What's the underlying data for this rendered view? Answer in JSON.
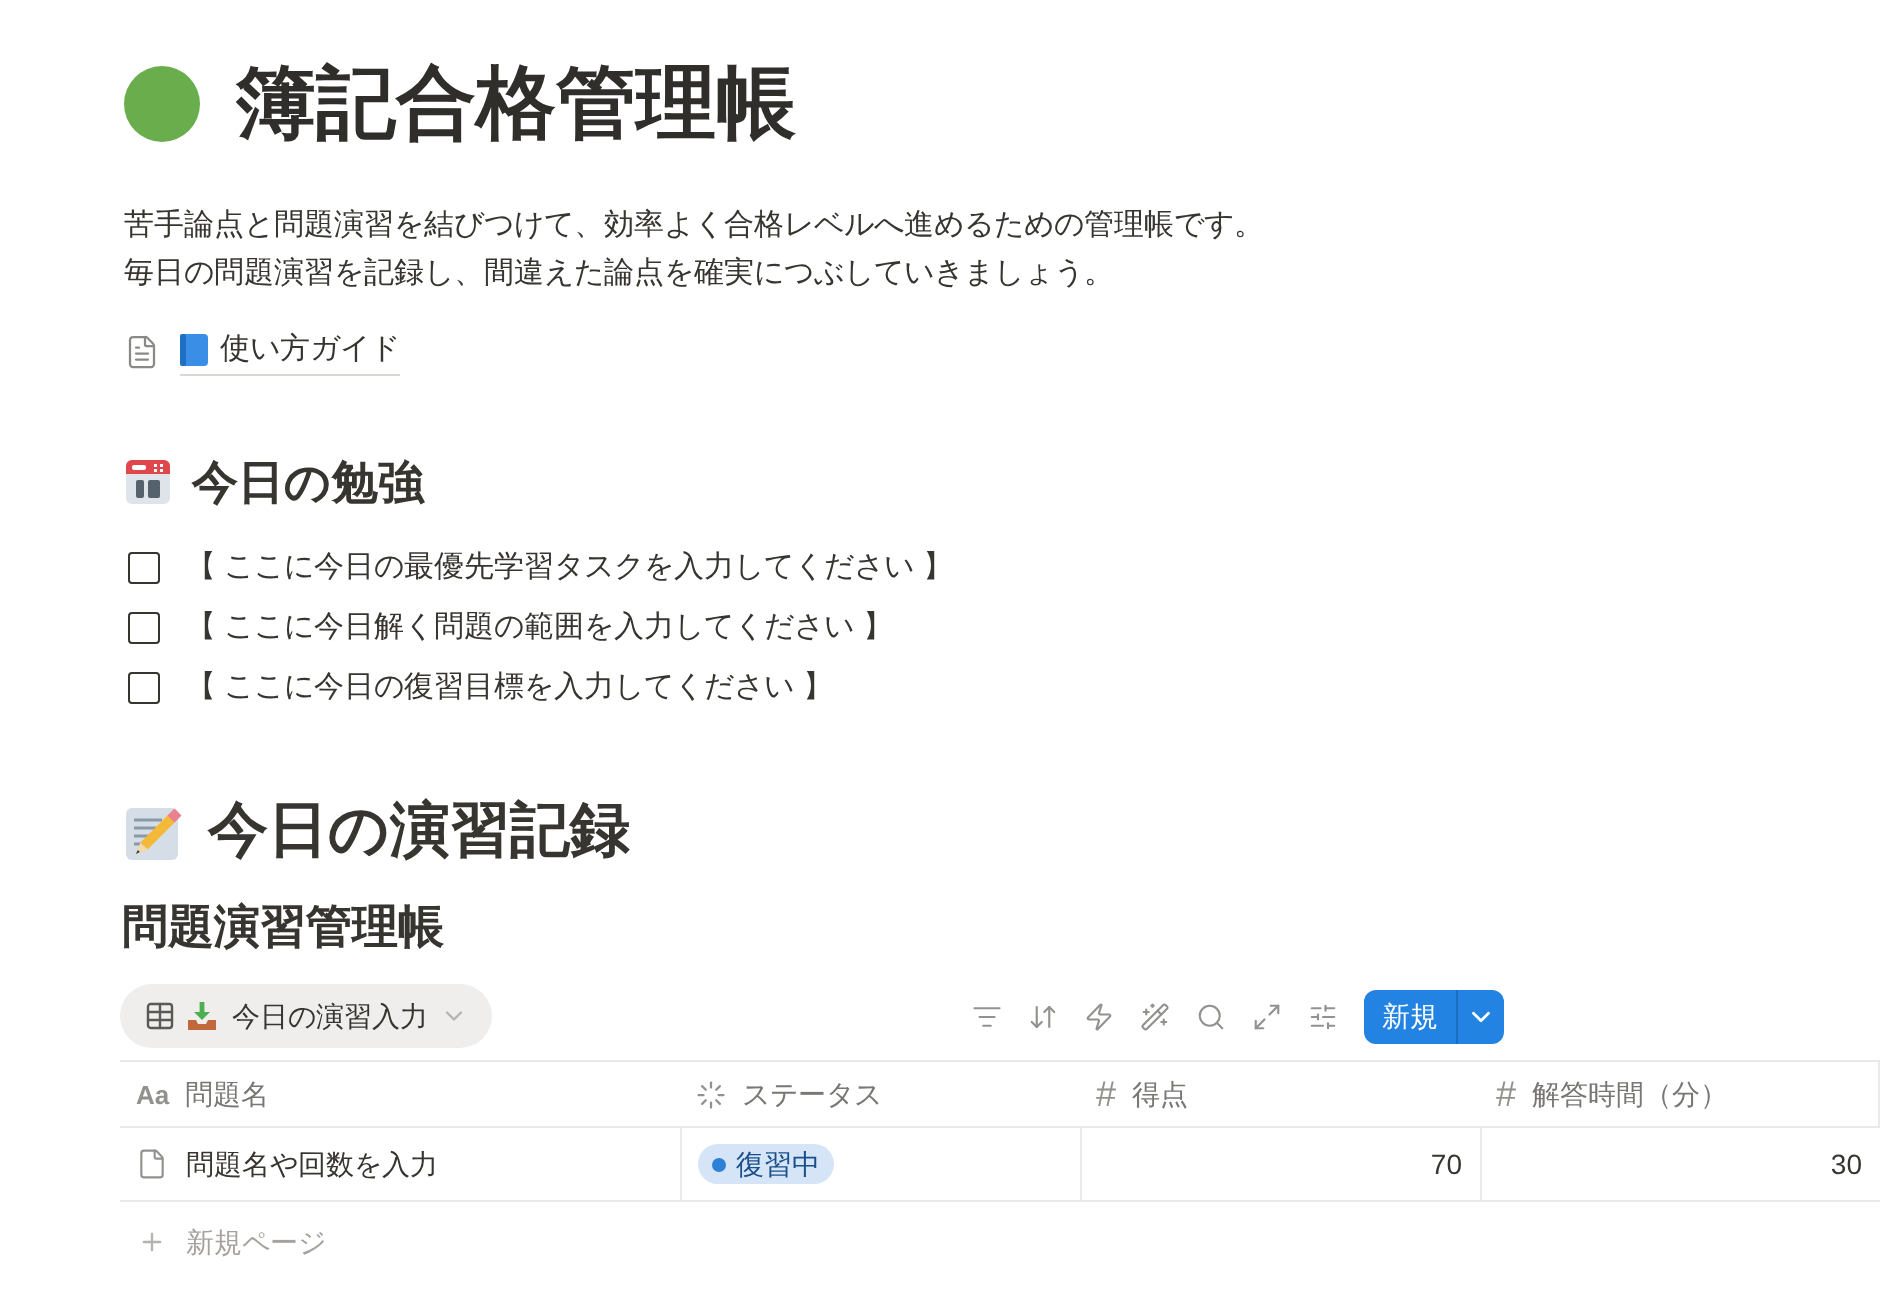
{
  "page": {
    "title": "簿記合格管理帳",
    "description": [
      "苦手論点と問題演習を結びつけて、効率よく合格レベルへ進めるための管理帳です。",
      "毎日の問題演習を記録し、間違えた論点を確実につぶしていきましょう。"
    ],
    "link": {
      "label": "使い方ガイド"
    }
  },
  "today_study": {
    "heading": "今日の勉強",
    "tasks": [
      {
        "label": "【 ここに今日の最優先学習タスクを入力してください 】",
        "checked": false
      },
      {
        "label": "【 ここに今日解く問題の範囲を入力してください 】",
        "checked": false
      },
      {
        "label": "【 ここに今日の復習目標を入力してください 】",
        "checked": false
      }
    ]
  },
  "practice_log": {
    "heading": "今日の演習記録",
    "database": {
      "title": "問題演習管理帳",
      "views": [
        {
          "label": "今日の演習入力",
          "selected": true
        }
      ],
      "new_button": "新規",
      "columns": [
        {
          "kind": "title",
          "icon_text": "Aa",
          "label": "問題名"
        },
        {
          "kind": "status",
          "label": "ステータス"
        },
        {
          "kind": "number",
          "icon_text": "#",
          "label": "得点"
        },
        {
          "kind": "number",
          "icon_text": "#",
          "label": "解答時間（分）"
        }
      ],
      "rows": [
        {
          "cells": [
            {
              "kind": "title",
              "text": "問題名や回数を入力"
            },
            {
              "kind": "status",
              "text": "復習中",
              "color": "#2e7fd6"
            },
            {
              "kind": "number",
              "text": "70"
            },
            {
              "kind": "number",
              "text": "30"
            }
          ]
        }
      ],
      "add_row": "新規ページ"
    }
  }
}
